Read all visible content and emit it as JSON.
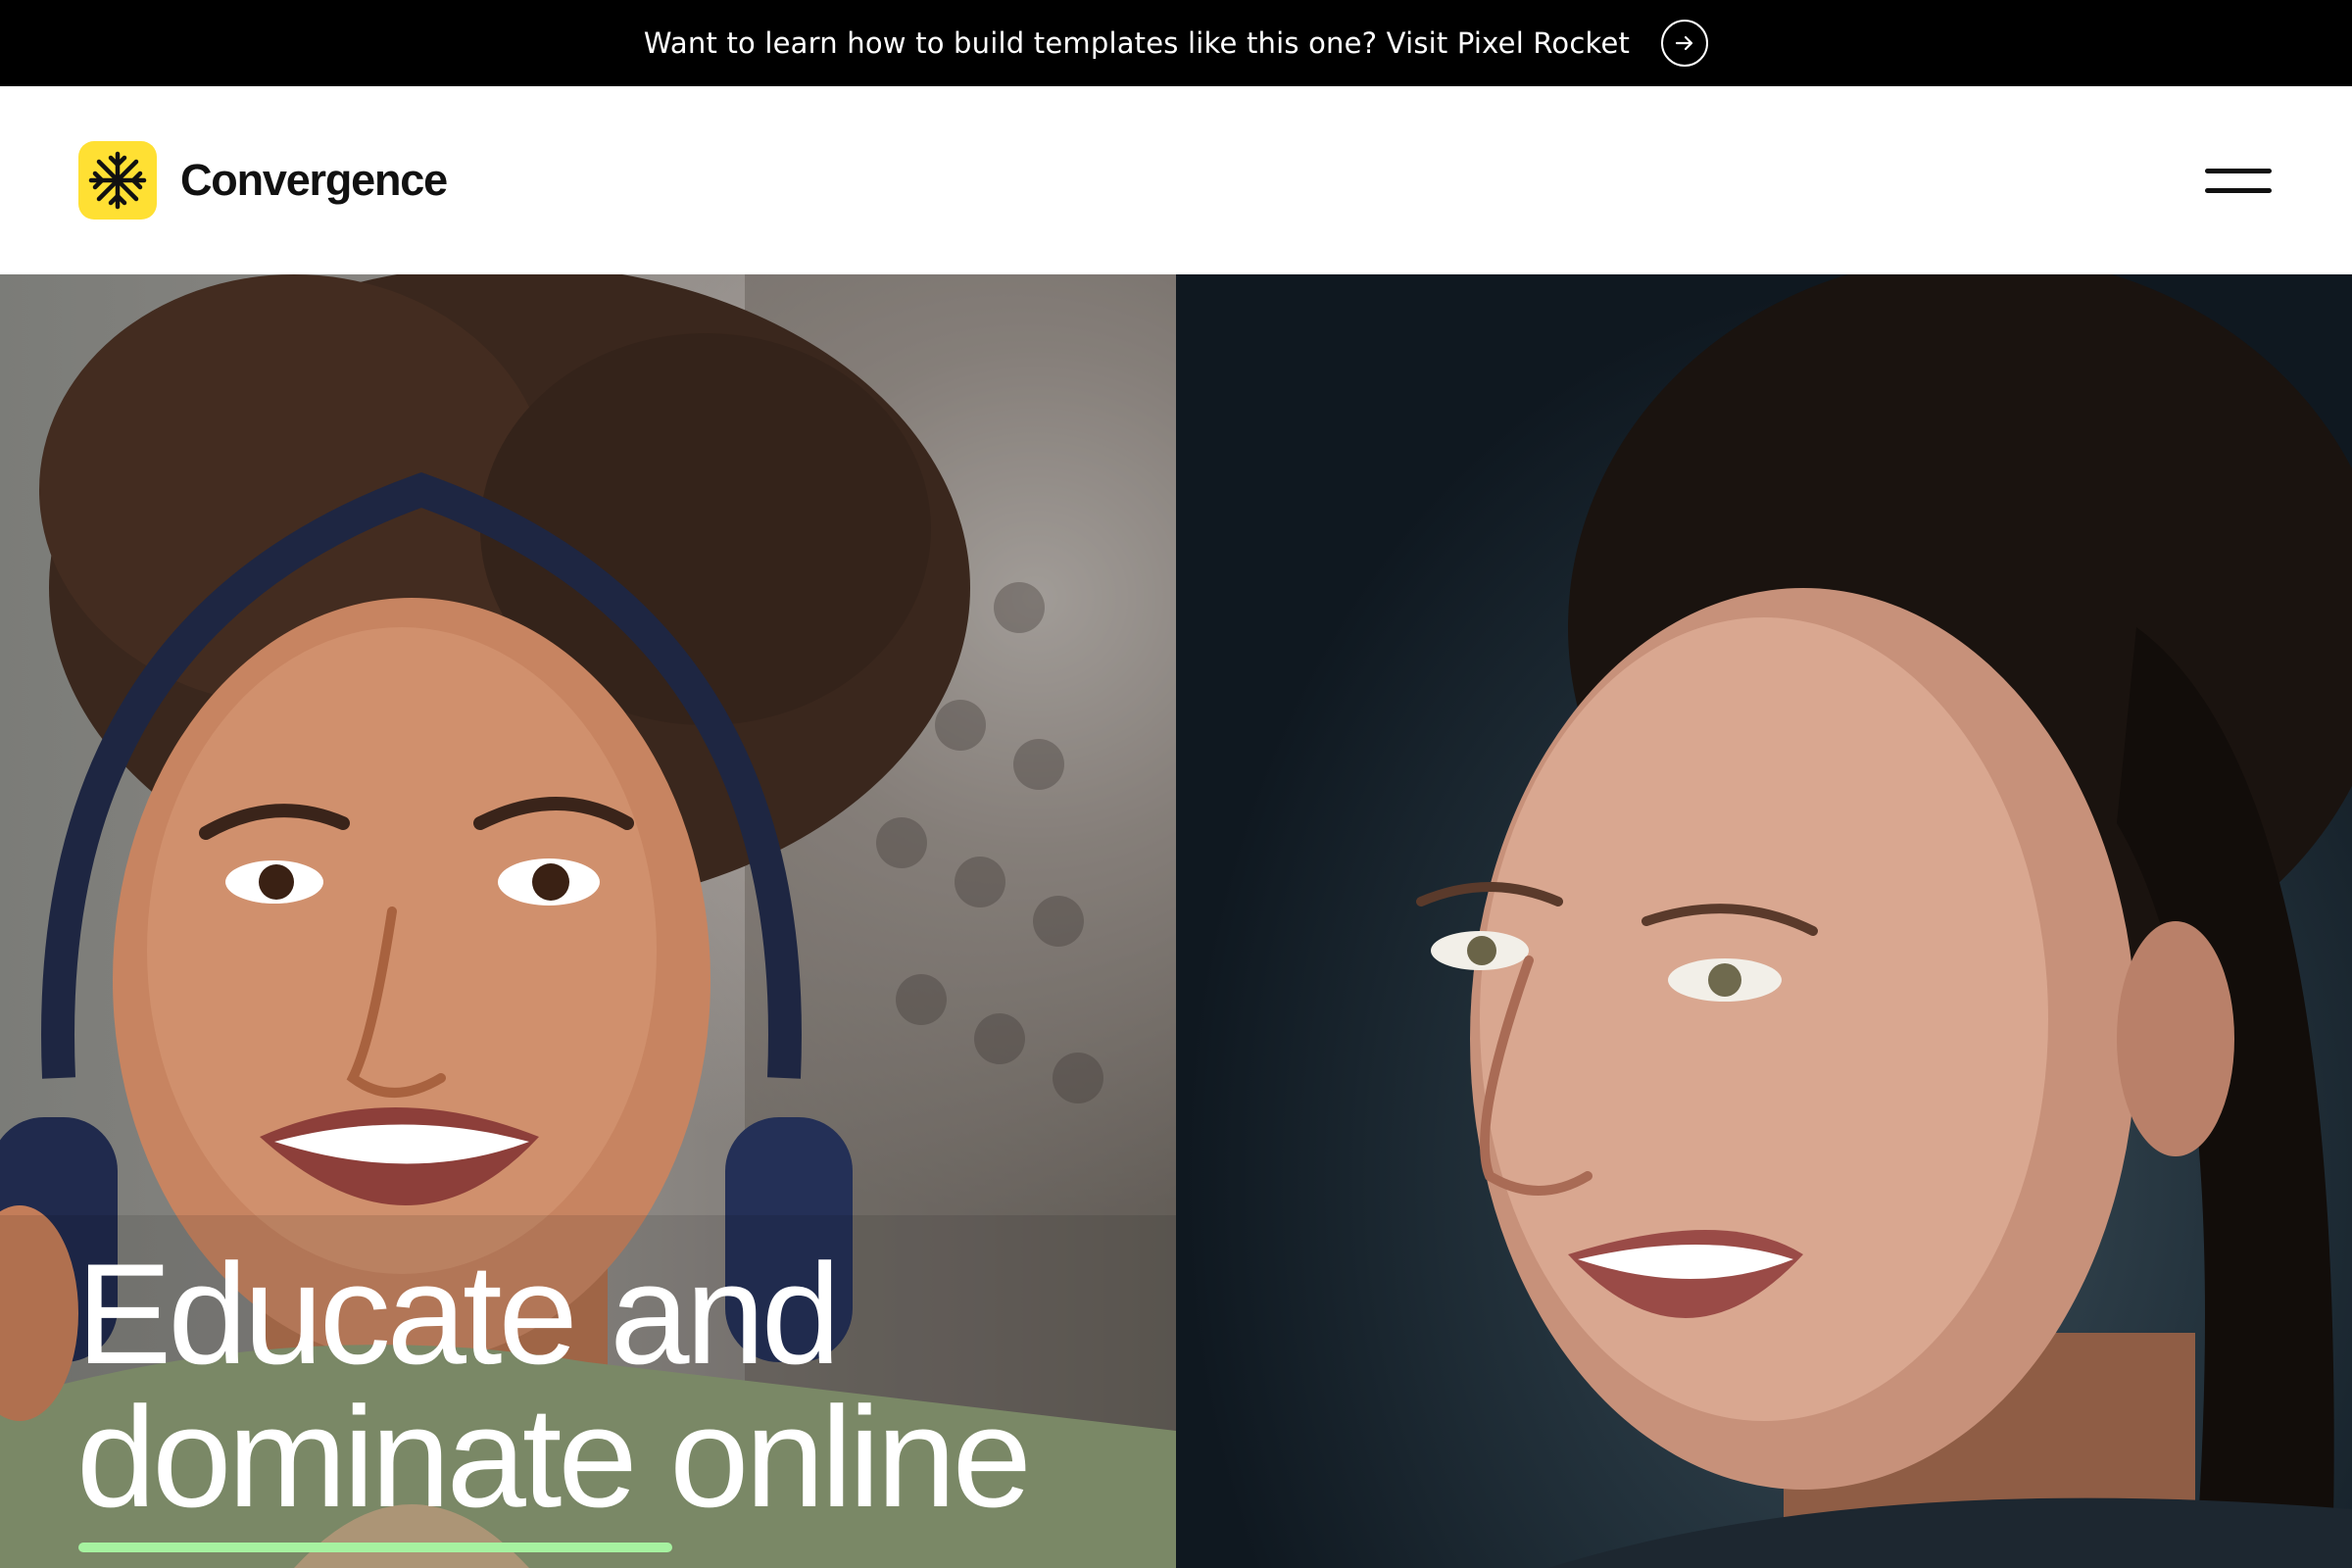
{
  "announcement": {
    "text": "Want to learn how to build templates like this one? Visit Pixel Rocket",
    "arrow_icon": "arrow-right-icon"
  },
  "header": {
    "brand": "Convergence",
    "logo_icon": "asterisk-logo-icon",
    "menu_icon": "hamburger-menu-icon"
  },
  "hero": {
    "title_line1": "Educate and",
    "title_line2": "dominate online",
    "left_image": "woman-with-headphones-photo",
    "right_image": "smiling-woman-photo"
  },
  "colors": {
    "announcement_bg": "#000000",
    "logo_bg": "#ffe033",
    "accent_underline": "#a6f2a0",
    "text_dark": "#111111",
    "text_light": "#ffffff"
  }
}
